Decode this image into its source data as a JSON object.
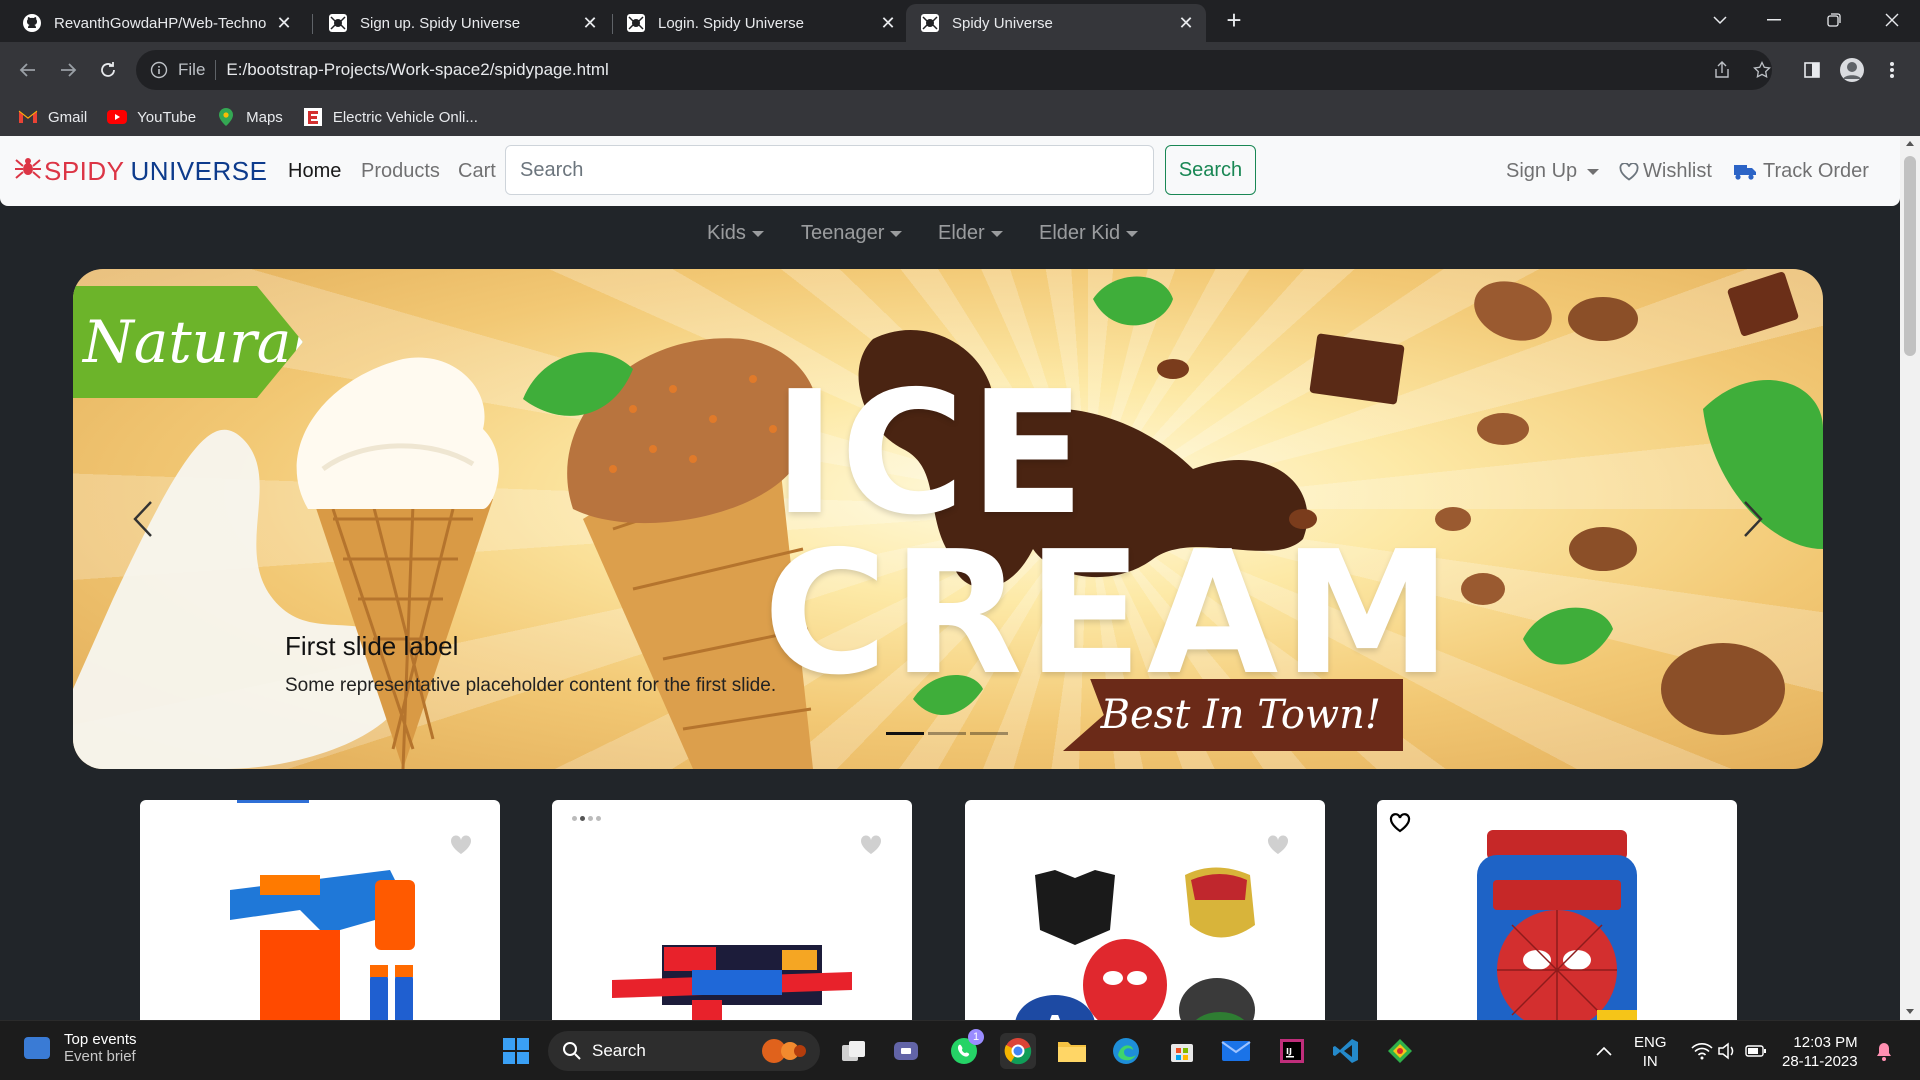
{
  "browser": {
    "tabs": [
      {
        "title": "RevanthGowdaHP/Web-Technol",
        "icon": "github-icon"
      },
      {
        "title": "Sign up. Spidy Universe",
        "icon": "spider-icon"
      },
      {
        "title": "Login. Spidy Universe",
        "icon": "spider-icon"
      },
      {
        "title": "Spidy Universe",
        "icon": "spider-icon",
        "active": true
      }
    ],
    "address": {
      "scheme_label": "File",
      "url": "E:/bootstrap-Projects/Work-space2/spidypage.html"
    },
    "bookmarks": [
      {
        "label": "Gmail",
        "icon": "gmail-icon"
      },
      {
        "label": "YouTube",
        "icon": "youtube-icon"
      },
      {
        "label": "Maps",
        "icon": "maps-icon"
      },
      {
        "label": "Electric Vehicle Onli...",
        "icon": "ev-site-icon"
      }
    ]
  },
  "site": {
    "brand": {
      "part1": "SPIDY",
      "part2": "UNIVERSE"
    },
    "nav": {
      "home": "Home",
      "products": "Products",
      "cart": "Cart"
    },
    "search": {
      "placeholder": "Search",
      "button": "Search"
    },
    "right": {
      "signup": "Sign Up",
      "wishlist": "Wishlist",
      "track": "Track Order"
    },
    "categories": [
      "Kids",
      "Teenager",
      "Elder",
      "Elder Kid"
    ],
    "carousel": {
      "tag": "Natural",
      "headline1": "ICE",
      "headline2": "CREAM",
      "banner": "Best In Town!",
      "caption_title": "First slide label",
      "caption_text": "Some representative placeholder content for the first slide.",
      "slides": 3,
      "active_slide": 1
    },
    "products": [
      {
        "name": "nerf-blaster-blue-orange"
      },
      {
        "name": "nerf-strike-blaster"
      },
      {
        "name": "superhero-masks-set"
      },
      {
        "name": "spiderman-backpack"
      }
    ]
  },
  "taskbar": {
    "widget": {
      "title": "Top events",
      "subtitle": "Event brief"
    },
    "search": "Search",
    "whatsapp_badge": "1",
    "lang": {
      "line1": "ENG",
      "line2": "IN"
    },
    "clock": {
      "time": "12:03 PM",
      "date": "28-11-2023"
    }
  },
  "colors": {
    "brand_red": "#dc3545",
    "brand_blue": "#0d3b8c",
    "success": "#198754"
  }
}
